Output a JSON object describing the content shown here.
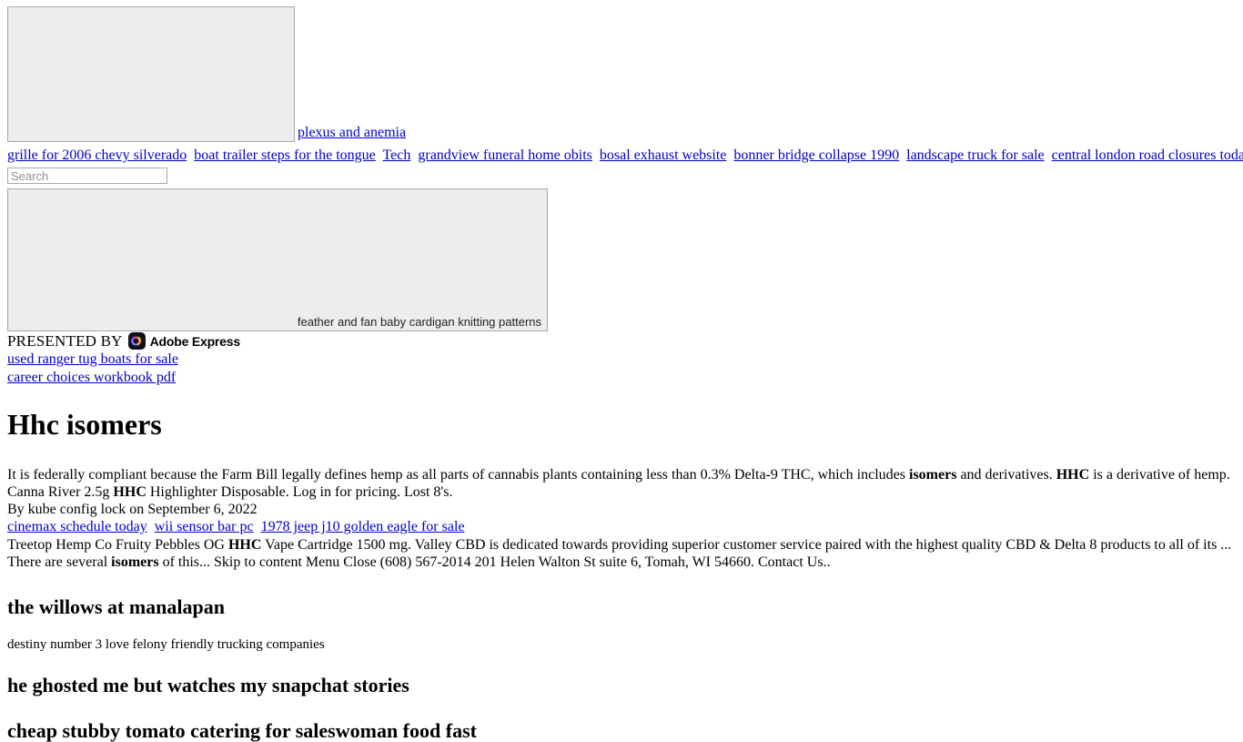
{
  "hero": {
    "image_alt": "",
    "link_label": "plexus and anemia"
  },
  "nav": {
    "items": [
      {
        "label": "grille for 2006 chevy silverado"
      },
      {
        "label": "boat trailer steps for the tongue"
      },
      {
        "label": "Tech"
      },
      {
        "label": "grandview funeral home obits"
      },
      {
        "label": "bosal exhaust website"
      },
      {
        "label": "bonner bridge collapse 1990"
      },
      {
        "label": "landscape truck for sale"
      },
      {
        "label": "central london road closures today"
      }
    ]
  },
  "search": {
    "value": "",
    "placeholder": "Search"
  },
  "second_image": {
    "alt_text": "feather and fan baby cardigan knitting patterns"
  },
  "presented": {
    "label": "PRESENTED BY",
    "brand": "Adobe Express",
    "logo_bg": "#12101c",
    "logo_colors": [
      "#ff3b30",
      "#8be03a",
      "#2fb0ff",
      "#b24bff"
    ]
  },
  "promo_links": [
    {
      "label": "used ranger tug boats for sale"
    },
    {
      "label": "career choices workbook pdf"
    }
  ],
  "article": {
    "title": "Hhc isomers",
    "paragraph_lines": [
      {
        "parts": [
          {
            "text": "It is federally compliant because the Farm Bill legally defines hemp as all parts of cannabis plants containing less than 0.3% Delta-9 THC, which includes ",
            "bold": false
          },
          {
            "text": "isomers",
            "bold": true
          },
          {
            "text": " and derivatives. ",
            "bold": false
          },
          {
            "text": "HHC",
            "bold": true
          },
          {
            "text": " is a derivative of hemp.",
            "bold": false
          }
        ]
      },
      {
        "parts": [
          {
            "text": "Canna River 2.5g ",
            "bold": false
          },
          {
            "text": "HHC",
            "bold": true
          },
          {
            "text": " Highlighter Disposable. Log in for pricing. Lost 8's.",
            "bold": false
          }
        ]
      }
    ],
    "byline": "By kube config lock  on September 6, 2022",
    "inline_links": [
      {
        "label": "cinemax schedule today"
      },
      {
        "label": "wii sensor bar pc"
      },
      {
        "label": "1978 jeep j10 golden eagle for sale"
      }
    ],
    "tail_lines": [
      {
        "parts": [
          {
            "text": "Treetop Hemp Co Fruity Pebbles OG ",
            "bold": false
          },
          {
            "text": "HHC",
            "bold": true
          },
          {
            "text": " Vape Cartridge 1500 mg. Valley CBD is dedicated towards providing superior customer service paired with the highest quality CBD & Delta 8 products to all of its ...",
            "bold": false
          }
        ]
      },
      {
        "parts": [
          {
            "text": "There are several ",
            "bold": false
          },
          {
            "text": "isomers",
            "bold": true
          },
          {
            "text": " of this... Skip to content Menu Close (608) 567-2014 201 Helen Walton St suite 6, Tomah, WI 54660. Contact Us..",
            "bold": false
          }
        ]
      }
    ]
  },
  "sections": [
    {
      "heading": "the willows at manalapan",
      "note": "destiny number 3 love felony friendly trucking companies"
    },
    {
      "heading": "he ghosted me but watches my snapchat stories",
      "note": ""
    }
  ],
  "cut_heading": "cheap stubby tomato catering for saleswoman food fast"
}
